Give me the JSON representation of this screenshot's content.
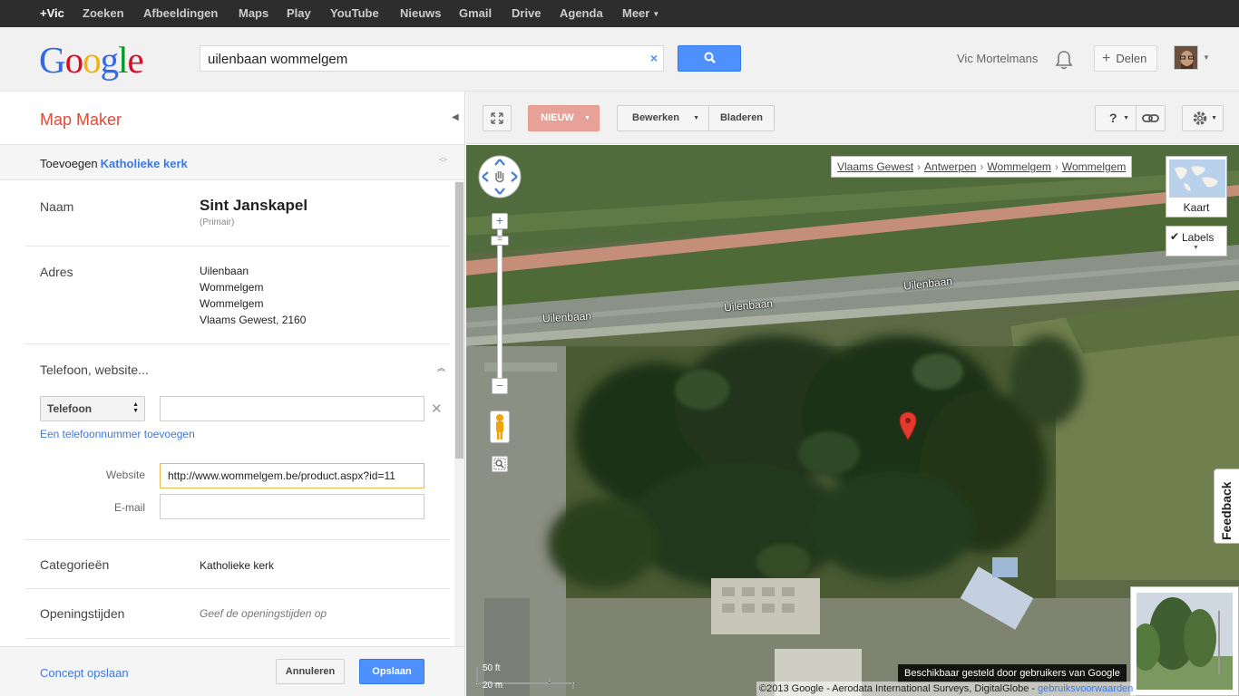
{
  "topbar": {
    "items": [
      "+Vic",
      "Zoeken",
      "Afbeeldingen",
      "Maps",
      "Play",
      "YouTube",
      "Nieuws",
      "Gmail",
      "Drive",
      "Agenda",
      "Meer"
    ]
  },
  "header": {
    "logo_letters": [
      "G",
      "o",
      "o",
      "g",
      "l",
      "e"
    ],
    "search_value": "uilenbaan wommelgem",
    "clear_symbol": "×",
    "username": "Vic Mortelmans",
    "share_label": "Delen"
  },
  "panel": {
    "title": "Map Maker",
    "add_label": "Toevoegen",
    "add_category": "Katholieke kerk",
    "name_label": "Naam",
    "name_value": "Sint Janskapel",
    "name_note": "(Primair)",
    "address_label": "Adres",
    "address_lines": [
      "Uilenbaan",
      "Wommelgem",
      "Wommelgem",
      "Vlaams Gewest, 2160"
    ],
    "phone_section_label": "Telefoon, website...",
    "phone_type": "Telefoon",
    "phone_value": "",
    "add_phone_link": "Een telefoonnummer toevoegen",
    "website_label": "Website",
    "website_value": "http://www.wommelgem.be/product.aspx?id=11",
    "email_label": "E-mail",
    "email_value": "",
    "categories_label": "Categorieën",
    "categories_value": "Katholieke kerk",
    "hours_label": "Openingstijden",
    "hours_placeholder": "Geef de openingstijden op",
    "draft_link": "Concept opslaan",
    "cancel_label": "Annuleren",
    "save_label": "Opslaan"
  },
  "toolbar": {
    "new_label": "NIEUW",
    "edit_label": "Bewerken",
    "browse_label": "Bladeren",
    "help_label": "?"
  },
  "map": {
    "breadcrumb": [
      "Vlaams Gewest",
      "Antwerpen",
      "Wommelgem",
      "Wommelgem"
    ],
    "breadcrumb_separator": "›",
    "map_type_label": "Kaart",
    "labels_toggle": "Labels",
    "labels_checked": true,
    "road_labels": [
      "Uilenbaan",
      "Uilenbaan",
      "Uilenbaan"
    ],
    "scale_top": "50 ft",
    "scale_bottom": "20 m",
    "attribution": "Beschikbaar gesteld door gebruikers van Google",
    "copyright": "©2013 Google - Aerodata International Surveys, DigitalGlobe -",
    "copyright_link": "gebruiksvoorwaarden",
    "feedback_label": "Feedback"
  },
  "colors": {
    "accent_blue": "#4d90fe",
    "link_blue": "#3b78e7",
    "map_maker_red": "#dd4b39",
    "new_button": "#e8a198"
  }
}
